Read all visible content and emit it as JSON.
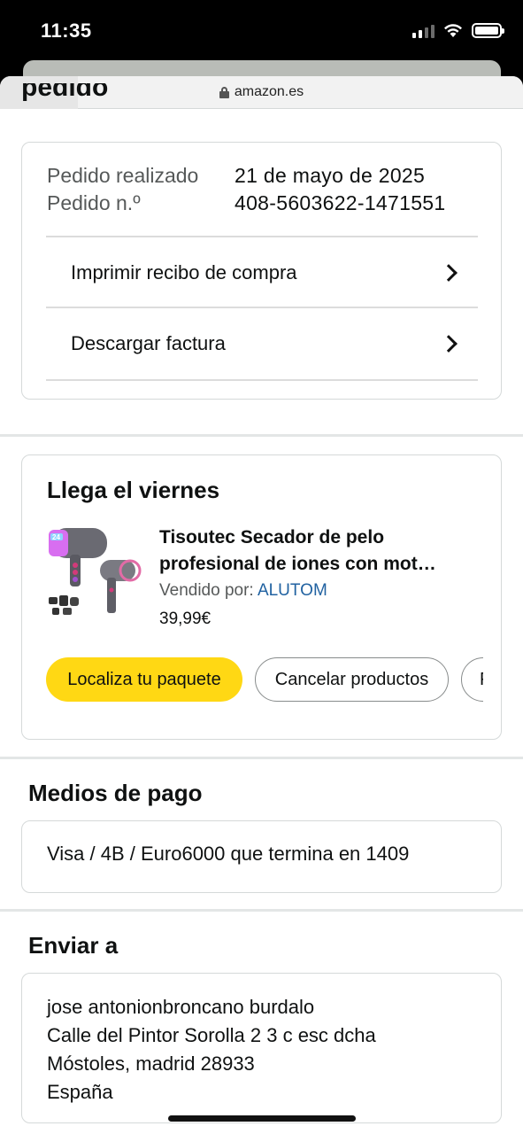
{
  "status_bar": {
    "time": "11:35"
  },
  "browser": {
    "url": "amazon.es"
  },
  "partial_heading": "pedido",
  "order": {
    "placed_label": "Pedido realizado",
    "placed_value": "21 de mayo de 2025",
    "number_label": "Pedido n.º",
    "number_value": "408-5603622-1471551",
    "links": [
      {
        "label": "Imprimir recibo de compra"
      },
      {
        "label": "Descargar factura"
      }
    ]
  },
  "delivery": {
    "title": "Llega el viernes",
    "product": {
      "name_line1": "Tisoutec Secador de pelo",
      "name_line2": "profesional de iones con mot…",
      "seller_label": "Vendido por:",
      "seller_name": "ALUTOM",
      "price": "39,99€"
    },
    "buttons": {
      "track": "Localiza tu paquete",
      "cancel": "Cancelar productos",
      "partial": "P"
    }
  },
  "payment": {
    "title": "Medios de pago",
    "method": "Visa / 4B / Euro6000",
    "ending": "que termina en 1409"
  },
  "shipping": {
    "title": "Enviar a",
    "lines": [
      "jose antonionbroncano burdalo",
      "Calle del Pintor Sorolla 2 3 c esc dcha",
      "Móstoles, madrid 28933",
      "España"
    ]
  },
  "colors": {
    "primary_button": "#ffd814",
    "link": "#2162a1",
    "secondary_text": "#565959"
  }
}
